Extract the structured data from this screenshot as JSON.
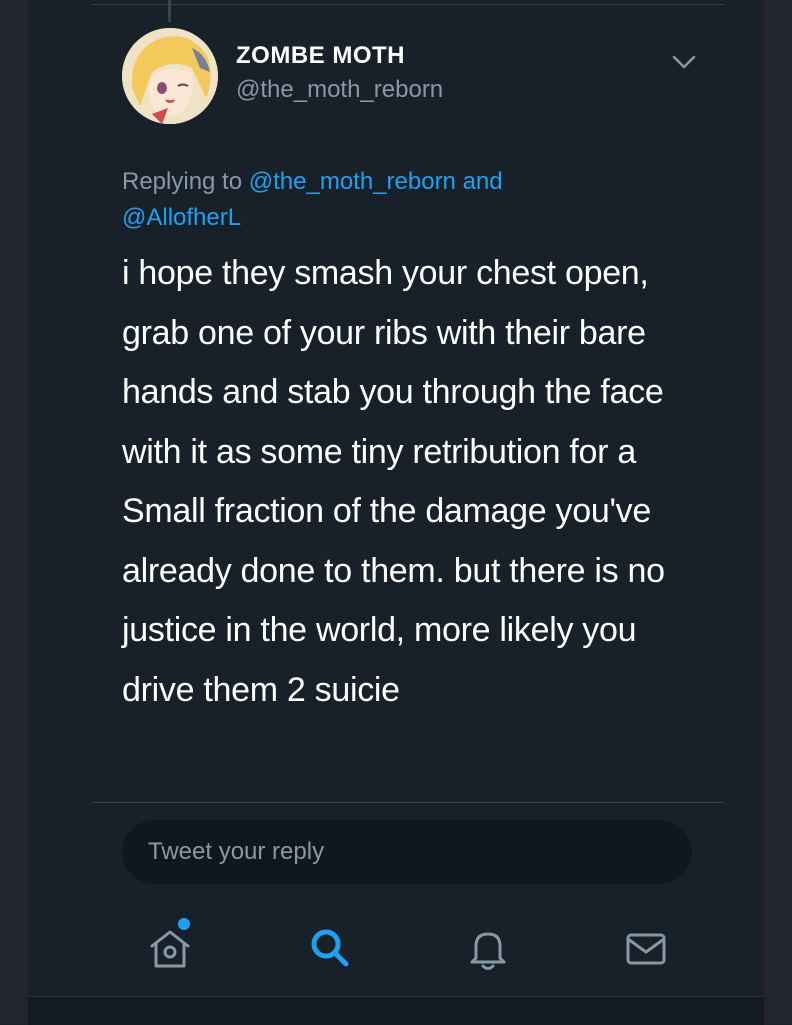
{
  "tweet": {
    "display_name": "ZOMBE MOTH",
    "handle": "@the_moth_reborn",
    "replying_prefix": "Replying to",
    "replying_mention_1": "@the_moth_reborn",
    "replying_and": "and",
    "replying_mention_2": "@AllofherL",
    "text": "i hope they smash your chest open, grab one of your ribs with their bare hands and stab you through the face with it as some tiny retribution for a Small fraction of the damage you've already done to them. but there is no justice in the world, more likely you drive them 2 suicie"
  },
  "reply_box": {
    "placeholder": "Tweet your reply"
  },
  "tab_bar": {
    "tabs": [
      {
        "icon": "home-icon",
        "active": false,
        "has_notification_dot": true
      },
      {
        "icon": "search-icon",
        "active": true
      },
      {
        "icon": "bell-icon",
        "active": false
      },
      {
        "icon": "mail-icon",
        "active": false
      }
    ]
  },
  "colors": {
    "background": "#18202a",
    "accent": "#1da1f2",
    "secondary_text": "#8899a6",
    "primary_text": "#ffffff"
  }
}
